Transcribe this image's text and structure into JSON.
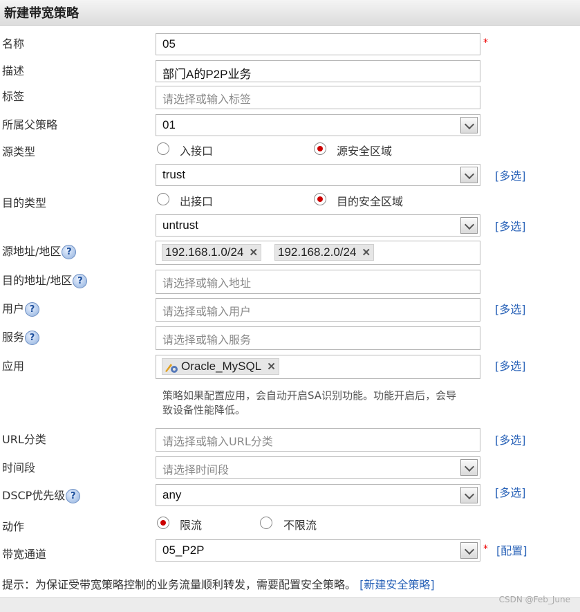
{
  "window": {
    "title": "新建带宽策略"
  },
  "form": {
    "name": {
      "label": "名称",
      "value": "05",
      "required": "*"
    },
    "description": {
      "label": "描述",
      "value": "部门A的P2P业务"
    },
    "tag": {
      "label": "标签",
      "placeholder": "请选择或输入标签"
    },
    "parent_policy": {
      "label": "所属父策略",
      "value": "01"
    },
    "source_type": {
      "label": "源类型",
      "option_interface": "入接口",
      "option_zone": "源安全区域",
      "selected": "源安全区域"
    },
    "source_zone": {
      "value": "trust",
      "multi": "[多选]"
    },
    "dest_type": {
      "label": "目的类型",
      "option_interface": "出接口",
      "option_zone": "目的安全区域",
      "selected": "目的安全区域"
    },
    "dest_zone": {
      "value": "untrust",
      "multi": "[多选]"
    },
    "source_address": {
      "label": "源地址/地区",
      "help": "?",
      "tags": [
        "192.168.1.0/24",
        "192.168.2.0/24"
      ],
      "remove": "✕"
    },
    "dest_address": {
      "label": "目的地址/地区",
      "help": "?",
      "placeholder": "请选择或输入地址"
    },
    "user": {
      "label": "用户",
      "help": "?",
      "placeholder": "请选择或输入用户",
      "multi": "[多选]"
    },
    "service": {
      "label": "服务",
      "help": "?",
      "placeholder": "请选择或输入服务"
    },
    "application": {
      "label": "应用",
      "tags": [
        "Oracle_MySQL"
      ],
      "remove": "✕",
      "multi": "[多选]",
      "hint": "策略如果配置应用，会自动开启SA识别功能。功能开启后，会导致设备性能降低。"
    },
    "url_category": {
      "label": "URL分类",
      "placeholder": "请选择或输入URL分类",
      "multi": "[多选]"
    },
    "time_range": {
      "label": "时间段",
      "placeholder": "请选择时间段"
    },
    "dscp": {
      "label": "DSCP优先级",
      "help": "?",
      "value": "any",
      "multi": "[多选]"
    },
    "action": {
      "label": "动作",
      "option_limit": "限流",
      "option_nolimit": "不限流",
      "selected": "限流"
    },
    "bandwidth_channel": {
      "label": "带宽通道",
      "value": "05_P2P",
      "required": "*",
      "config": "[配置]"
    }
  },
  "footer": {
    "tip": "提示：为保证受带宽策略控制的业务流量顺利转发，需要配置安全策略。",
    "link": "[新建安全策略]"
  },
  "watermark": "CSDN @Feb_June"
}
